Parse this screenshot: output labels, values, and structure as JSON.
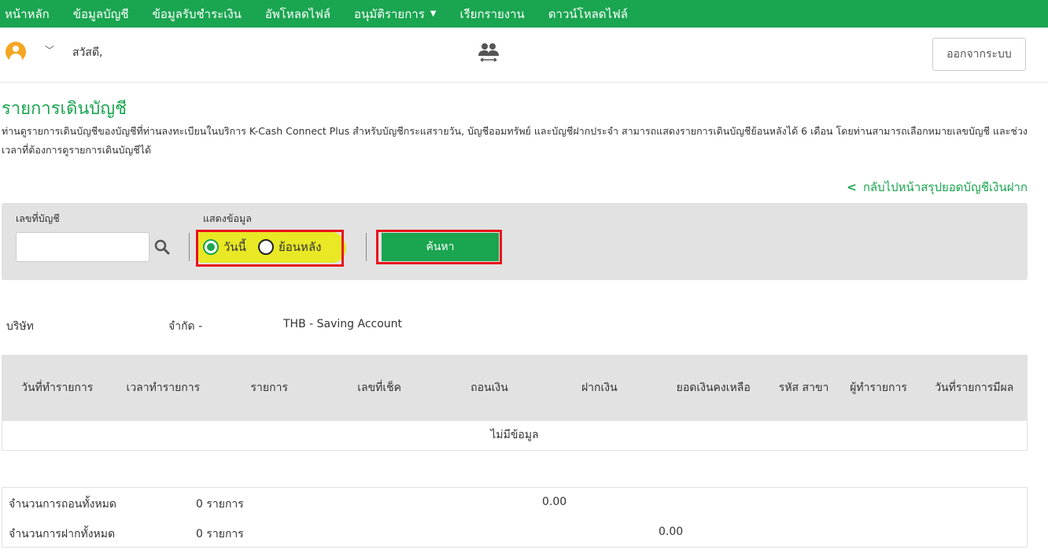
{
  "nav": {
    "items": [
      {
        "label": "หน้าหลัก"
      },
      {
        "label": "ข้อมูลบัญชี"
      },
      {
        "label": "ข้อมูลรับชำระเงิน"
      },
      {
        "label": "อัพโหลดไฟล์"
      },
      {
        "label": "อนุมัติรายการ",
        "caret": "▼"
      },
      {
        "label": "เรียกรายงาน"
      },
      {
        "label": "ดาวน์โหลดไฟล์"
      }
    ]
  },
  "user": {
    "greeting": "สวัสดี,",
    "chevron": "﹀",
    "logout_label": "ออกจากระบบ",
    "icons": {
      "avatar": "user-avatar-icon",
      "switch": "switch-user-icon"
    }
  },
  "page": {
    "title": "รายการเดินบัญชี",
    "description": "ท่านดูรายการเดินบัญชีของบัญชีที่ท่านลงทะเบียนในบริการ K-Cash Connect Plus สำหรับบัญชีกระแสรายวัน, บัญชีออมทรัพย์ และบัญชีฝากประจำ สามารถแสดงรายการเดินบัญชีย้อนหลังได้ 6 เดือน โดยท่านสามารถเลือกหมายเลขบัญชี และช่วงเวลาที่ต้องการดูรายการเดินบัญชีได้",
    "back_link_arrow": "<",
    "back_link": "กลับไปหน้าสรุปยอดบัญชีเงินฝาก"
  },
  "filter": {
    "account_label": "เลขที่บัญชี",
    "account_value": "",
    "display_label": "แสดงข้อมูล",
    "option_today": "วันนี้",
    "option_past": "ย้อนหลัง",
    "selected": "today",
    "search_button": "ค้นหา"
  },
  "account_info": {
    "company_prefix": "บริษัท",
    "company_suffix": "จำกัด -",
    "account_type": "THB - Saving Account"
  },
  "table": {
    "headers": [
      "วันที่ทำรายการ",
      "เวลาทำรายการ",
      "รายการ",
      "เลขที่เช็ค",
      "ถอนเงิน",
      "ฝากเงิน",
      "ยอดเงินคงเหลือ",
      "รหัส สาขา",
      "ผู้ทำรายการ",
      "วันที่รายการมีผล"
    ],
    "empty_message": "ไม่มีข้อมูล"
  },
  "summary": {
    "withdraw_label": "จำนวนการถอนทั้งหมด",
    "withdraw_count": "0 รายการ",
    "withdraw_total": "0.00",
    "deposit_label": "จำนวนการฝากทั้งหมด",
    "deposit_count": "0 รายการ",
    "deposit_total": "0.00"
  },
  "colors": {
    "brand_green": "#1aa550",
    "highlight_yellow": "#e8e825",
    "annotation_red": "#e8121a",
    "panel_gray": "#e2e2e2"
  }
}
